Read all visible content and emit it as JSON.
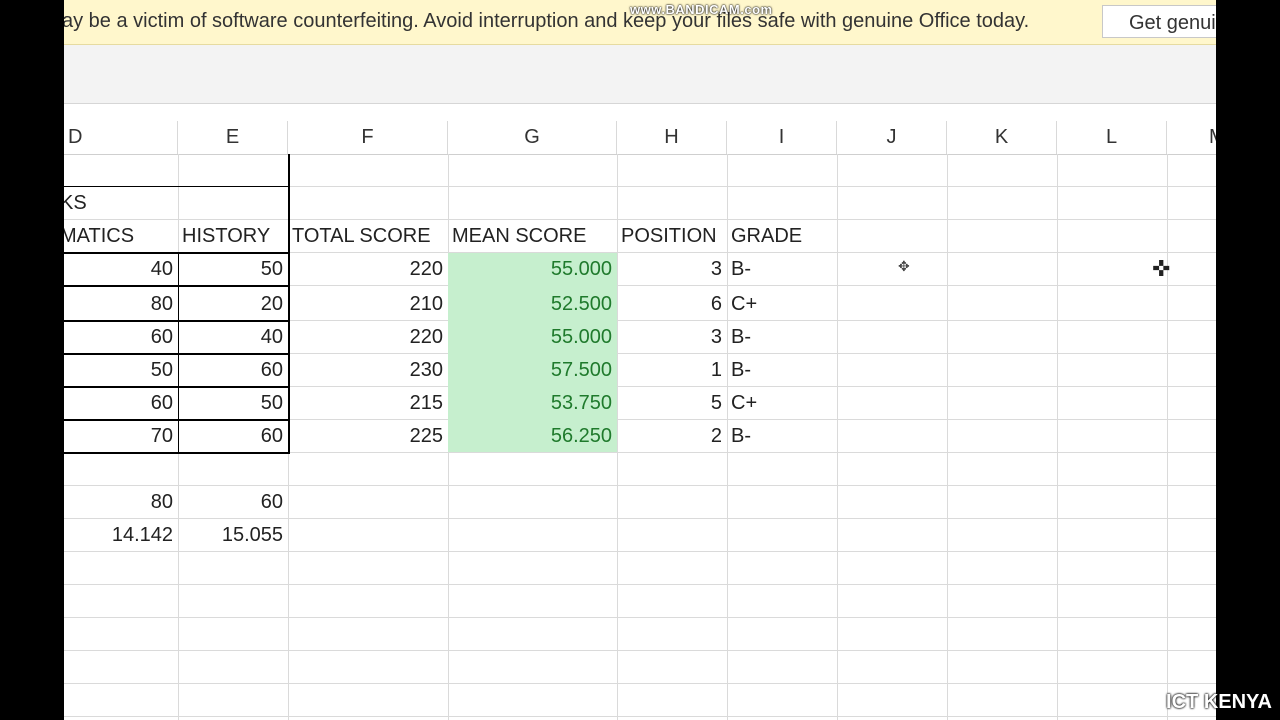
{
  "banner": {
    "message": "ay be a victim of software counterfeiting. Avoid interruption and keep your files safe with genuine Office today.",
    "button_label": "Get genui",
    "watermark": "www.BANDICAM.com"
  },
  "columns": [
    "D",
    "E",
    "F",
    "G",
    "H",
    "I",
    "J",
    "K",
    "L",
    "M"
  ],
  "labels": {
    "title_fragment": "KS",
    "mathematics": "MATICS",
    "history": "HISTORY",
    "total_score": "TOTAL SCORE",
    "mean_score": "MEAN SCORE",
    "position": "POSITION",
    "grade": "GRADE"
  },
  "rows": [
    {
      "math": "40",
      "history": "50",
      "total": "220",
      "mean": "55.000",
      "position": "3",
      "grade": "B-"
    },
    {
      "math": "80",
      "history": "20",
      "total": "210",
      "mean": "52.500",
      "position": "6",
      "grade": "C+"
    },
    {
      "math": "60",
      "history": "40",
      "total": "220",
      "mean": "55.000",
      "position": "3",
      "grade": "B-"
    },
    {
      "math": "50",
      "history": "60",
      "total": "230",
      "mean": "57.500",
      "position": "1",
      "grade": "B-"
    },
    {
      "math": "60",
      "history": "50",
      "total": "215",
      "mean": "53.750",
      "position": "5",
      "grade": "C+"
    },
    {
      "math": "70",
      "history": "60",
      "total": "225",
      "mean": "56.250",
      "position": "2",
      "grade": "B-"
    }
  ],
  "summary": [
    {
      "math": "80",
      "history": "60"
    },
    {
      "math": "14.142",
      "history": "15.055"
    }
  ],
  "credit": "ICT KENYA",
  "colors": {
    "mean_fill": "#c6efce",
    "mean_text": "#1f7a2c",
    "banner": "#fff7cc"
  }
}
